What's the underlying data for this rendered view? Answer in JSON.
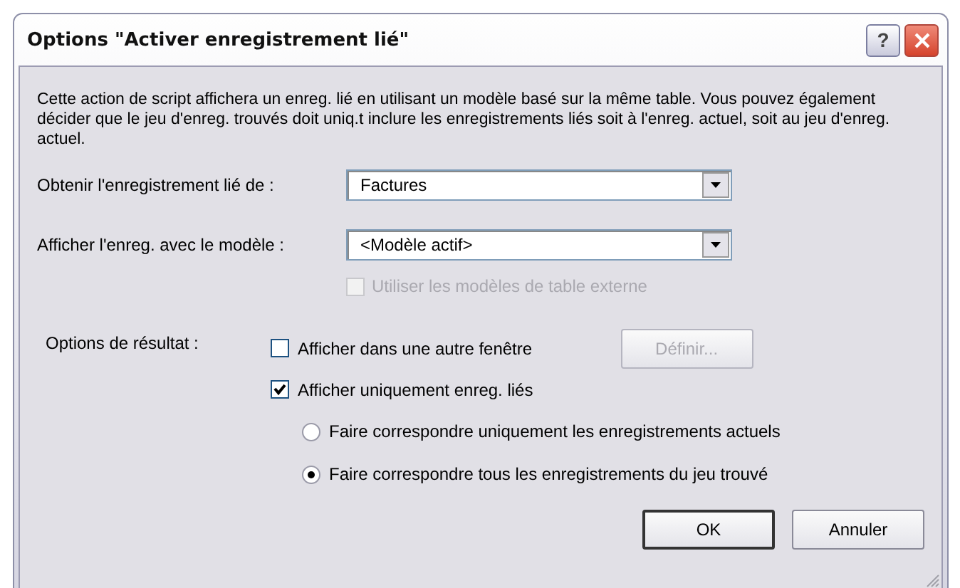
{
  "window": {
    "title": "Options \"Activer enregistrement lié\"",
    "help_button": "?"
  },
  "description": "Cette action de script affichera un enreg. lié en utilisant un modèle basé sur la même table. Vous pouvez également décider que le jeu d'enreg. trouvés doit uniq.t inclure les enregistrements liés soit à l'enreg. actuel, soit au jeu d'enreg. actuel.",
  "fields": [
    {
      "label": "Obtenir l'enregistrement lié de :",
      "value": "Factures"
    },
    {
      "label": "Afficher l'enreg. avec le modèle :",
      "value": "<Modèle actif>"
    }
  ],
  "external_templates": {
    "label": "Utiliser les modèles de table externe",
    "checked": false,
    "disabled": true
  },
  "result_options": {
    "label": "Options de résultat :",
    "items": [
      {
        "kind": "checkbox",
        "label": "Afficher dans une autre fenêtre",
        "checked": false,
        "button": {
          "label": "Définir...",
          "disabled": true
        }
      },
      {
        "kind": "checkbox",
        "label": "Afficher uniquement enreg. liés",
        "checked": true
      },
      {
        "kind": "radio",
        "label": "Faire correspondre uniquement les enregistrements actuels",
        "selected": false
      },
      {
        "kind": "radio",
        "label": "Faire correspondre tous les enregistrements du jeu trouvé",
        "selected": true
      }
    ]
  },
  "buttons": [
    {
      "label": "OK",
      "default": true
    },
    {
      "label": "Annuler",
      "default": false
    }
  ]
}
